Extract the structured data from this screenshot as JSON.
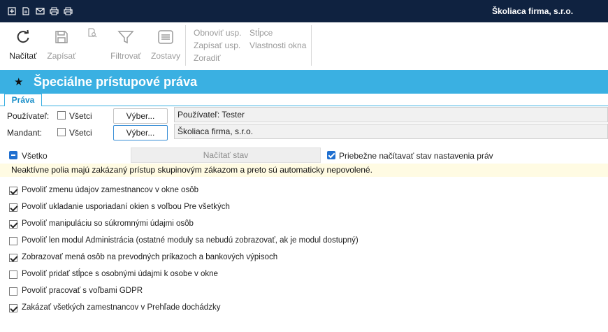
{
  "titlebar": {
    "company": "Školiaca firma, s.r.o.",
    "icons": [
      "export-icon",
      "document-icon",
      "mail-icon",
      "print-icon",
      "print-setup-icon"
    ]
  },
  "toolbar": {
    "load_label": "Načítať",
    "save_label": "Zapísať",
    "filter_label": "Filtrovať",
    "reports_label": "Zostavy",
    "restore_settings": "Obnoviť usp.",
    "save_settings": "Zapísať usp.",
    "sort": "Zoradiť",
    "columns": "Stĺpce",
    "window_properties": "Vlastnosti okna"
  },
  "header": {
    "title": "Špeciálne prístupové práva"
  },
  "tabs": [
    {
      "label": "Práva"
    }
  ],
  "form": {
    "user_label": "Používateľ:",
    "user_all_label": "Všetci",
    "user_select_button": "Výber...",
    "user_value": "Používateľ: Tester",
    "tenant_label": "Mandant:",
    "tenant_all_label": "Všetci",
    "tenant_select_button": "Výber...",
    "tenant_value": "Školiaca firma, s.r.o.",
    "all_label": "Všetko",
    "load_state_button": "Načítať stav",
    "continuous_load_label": "Priebežne načítavať stav nastavenia práv",
    "notice": "Neaktívne polia majú zakázaný prístup skupinovým zákazom a preto sú automaticky nepovolené."
  },
  "permissions": [
    {
      "label": "Povoliť zmenu údajov zamestnancov v okne osôb",
      "checked": true
    },
    {
      "label": "Povoliť ukladanie usporiadaní okien s voľbou Pre všetkých",
      "checked": true
    },
    {
      "label": "Povoliť manipuláciu so súkromnými údajmi osôb",
      "checked": true
    },
    {
      "label": "Povoliť len modul Administrácia (ostatné moduly sa nebudú zobrazovať, ak je modul dostupný)",
      "checked": false
    },
    {
      "label": "Zobrazovať mená osôb na prevodných príkazoch a bankových výpisoch",
      "checked": true
    },
    {
      "label": "Povoliť pridať stĺpce s osobnými údajmi k osobe v okne",
      "checked": false
    },
    {
      "label": "Povoliť pracovať s voľbami GDPR",
      "checked": false
    },
    {
      "label": "Zakázať všetkých zamestnancov v Prehľade dochádzky",
      "checked": true
    }
  ]
}
